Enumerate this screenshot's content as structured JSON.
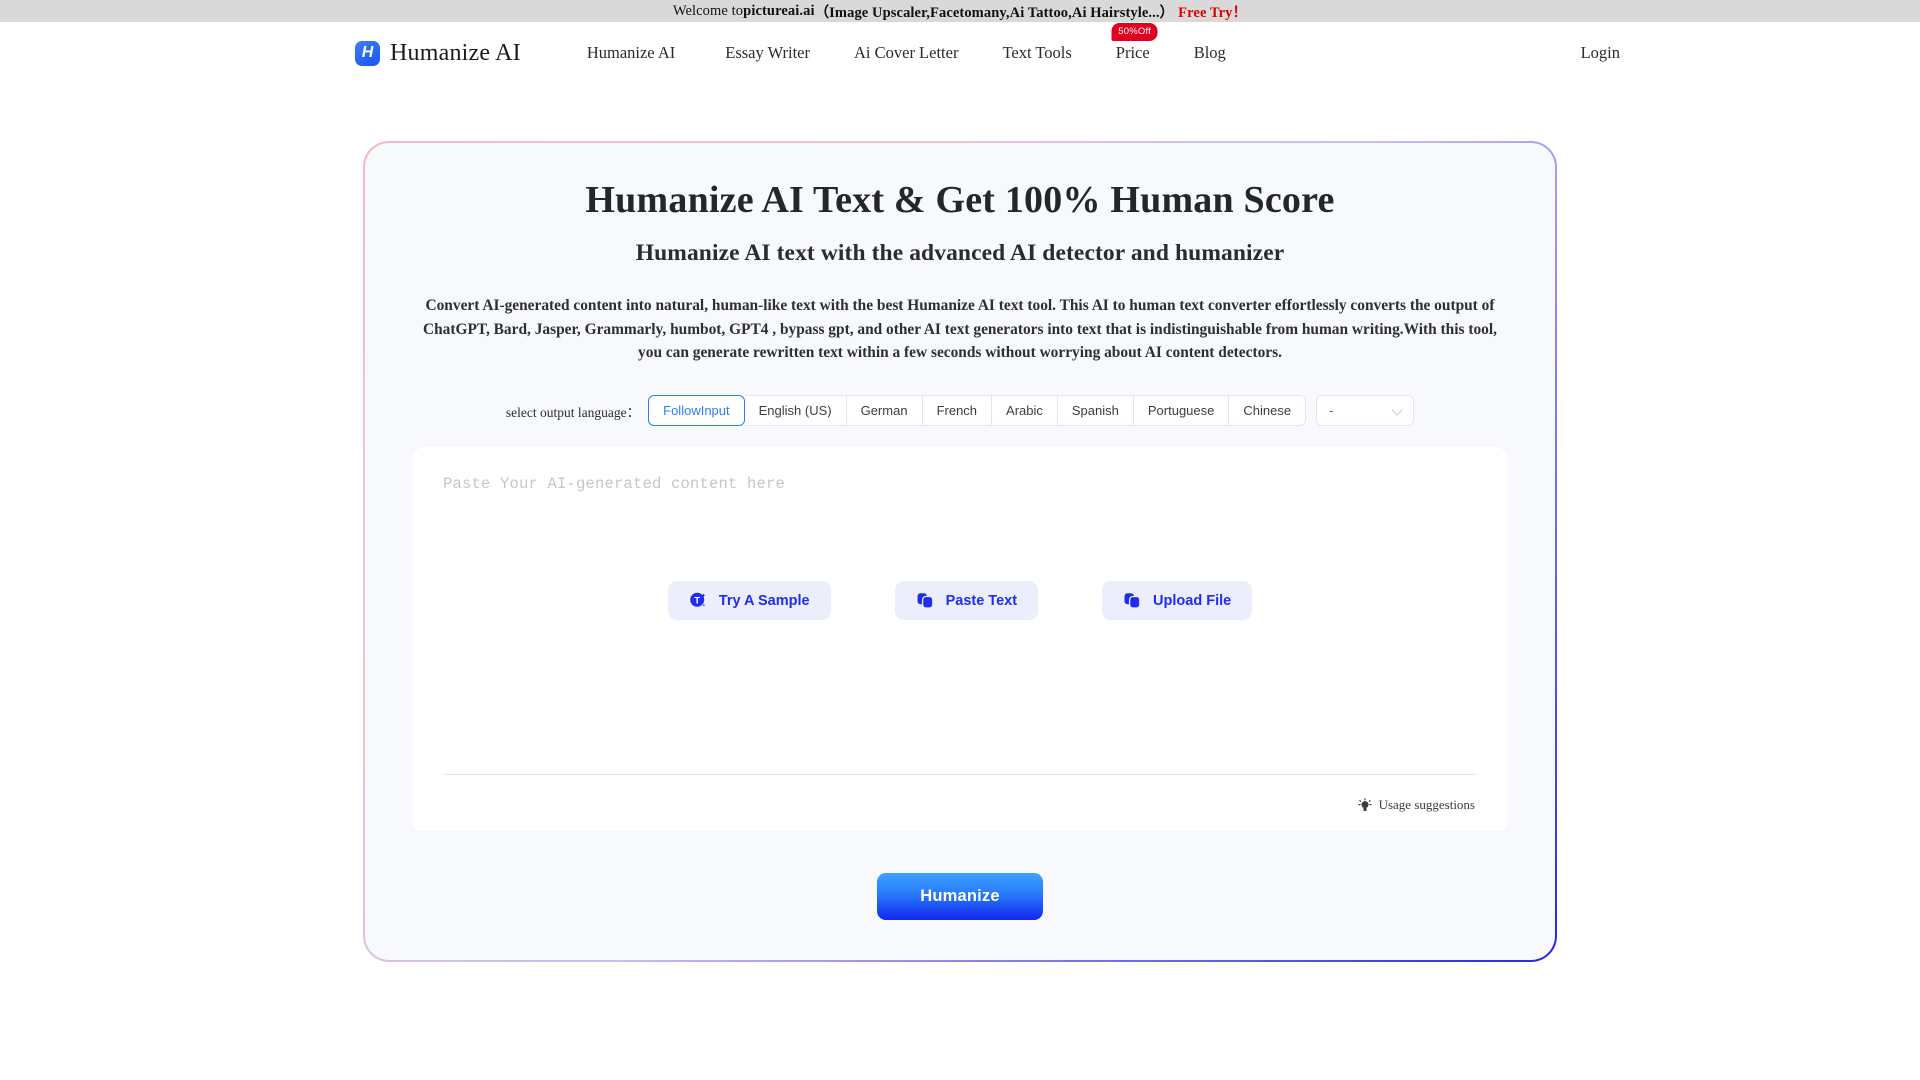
{
  "announcement": {
    "prefix": "Welcome to ",
    "brand": "pictureai.ai",
    "products": "（Image Upscaler,Facetomany,Ai Tattoo,Ai Hairstyle...）",
    "cta": "Free Try！"
  },
  "header": {
    "logo_letter": "H",
    "logo_text": "Humanize AI",
    "nav": [
      {
        "label": "Humanize AI"
      },
      {
        "label": "Essay Writer"
      },
      {
        "label": "Ai Cover Letter"
      },
      {
        "label": "Text Tools"
      },
      {
        "label": "Price",
        "badge": "50%Off"
      },
      {
        "label": "Blog"
      }
    ],
    "login_label": "Login"
  },
  "hero": {
    "title": "Humanize AI Text & Get 100% Human Score",
    "subtitle": "Humanize AI text with the advanced AI detector and humanizer",
    "description": "Convert AI-generated content into natural, human-like text with the best Humanize AI text tool. This AI to human text converter effortlessly converts the output of ChatGPT, Bard, Jasper, Grammarly, humbot, GPT4 , bypass gpt, and other AI text generators into text that is indistinguishable from human writing.With this tool, you can generate rewritten text within a few seconds without worrying about AI content detectors."
  },
  "language_selector": {
    "label": "select output language：",
    "options": [
      "FollowInput",
      "English (US)",
      "German",
      "French",
      "Arabic",
      "Spanish",
      "Portuguese",
      "Chinese"
    ],
    "selected": "FollowInput",
    "dropdown_value": "-"
  },
  "editor": {
    "placeholder": "Paste Your AI-generated content here",
    "actions": [
      {
        "label": "Try A Sample",
        "icon": "sample-text-icon"
      },
      {
        "label": "Paste Text",
        "icon": "paste-icon"
      },
      {
        "label": "Upload File",
        "icon": "upload-file-icon"
      }
    ],
    "usage_suggestions_label": "Usage suggestions",
    "usage_icon": "lightbulb-icon"
  },
  "cta": {
    "humanize_label": "Humanize"
  },
  "colors": {
    "accent_blue": "#1f2df0",
    "link_blue": "#2d7df6",
    "badge_red": "#e00020",
    "announce_red": "#e00000",
    "card_bg": "#f7f9fd"
  }
}
